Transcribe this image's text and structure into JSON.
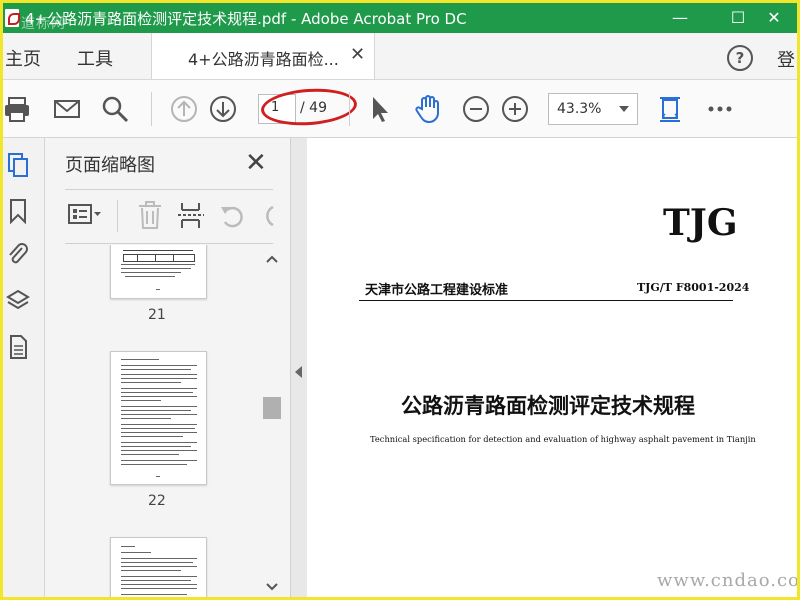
{
  "window": {
    "title": "4+公路沥青路面检测评定技术规程.pdf - Adobe Acrobat Pro DC",
    "watermark_logo": "道标网",
    "minimize": "—",
    "maximize": "☐",
    "close": "✕"
  },
  "menu": {
    "home": "主页",
    "tools": "工具",
    "tab_label": "4+公路沥青路面检...",
    "tab_close": "✕",
    "help": "?",
    "login": "登"
  },
  "toolbar": {
    "icons": [
      "print-icon",
      "email-icon",
      "search-icon",
      "page-up-icon",
      "page-down-icon",
      "select-cursor-icon",
      "hand-tool-icon",
      "zoom-out-icon",
      "zoom-in-icon",
      "fit-page-icon",
      "more-icon"
    ],
    "page_current": "1",
    "page_total": "/ 49",
    "zoom_value": "43.3%"
  },
  "panel": {
    "title": "页面缩略图",
    "close": "✕",
    "thumbnails": [
      {
        "label": "21"
      },
      {
        "label": "22"
      }
    ]
  },
  "document": {
    "brand": "TJG",
    "standard_name": "天津市公路工程建设标准",
    "standard_code": "TJG/T F8001-2024",
    "title": "公路沥青路面检测评定技术规程",
    "subtitle": "Technical specification for detection and evaluation of highway asphalt pavement in Tianjin",
    "site_watermark": "www.cndao.com"
  },
  "colors": {
    "titlebar": "#1f9a4a",
    "accent": "#2a6fd6",
    "highlight_oval": "#d01f1f",
    "frame": "#f2e62b"
  }
}
